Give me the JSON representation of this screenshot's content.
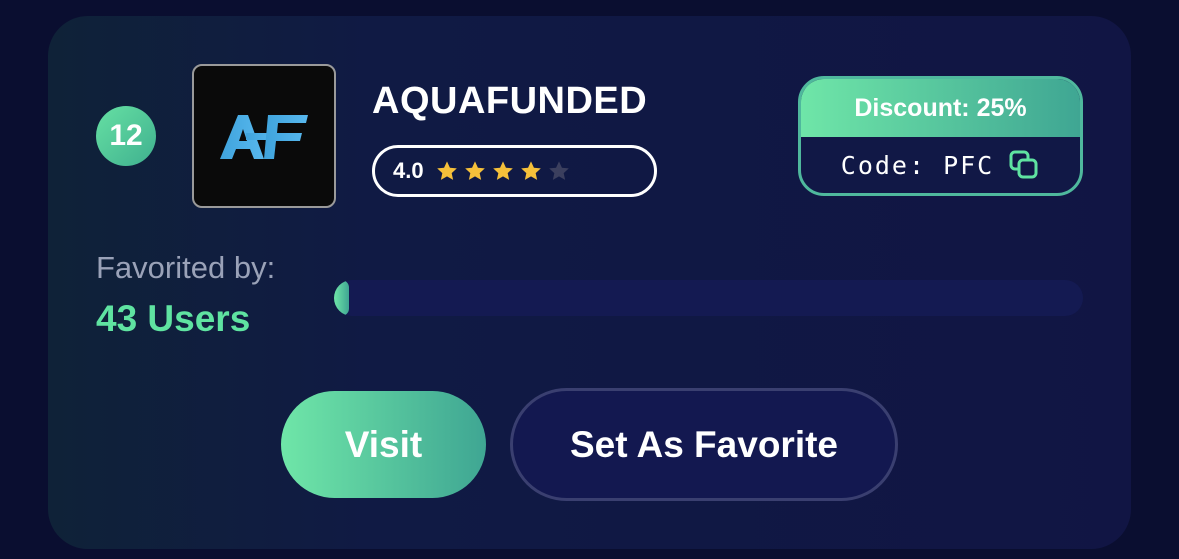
{
  "card": {
    "rank": "12",
    "logo_text": "AF",
    "name": "AQUAFUNDED",
    "rating": {
      "value": "4.0",
      "stars_filled": 4,
      "stars_total": 5,
      "star_color": "#f5c03a",
      "star_empty_color": "#3b3f5e"
    },
    "discount": {
      "label": "Discount: 25%",
      "code": "Code: PFC",
      "copy_icon": "copy-icon"
    },
    "favorites": {
      "label": "Favorited by:",
      "count": "43 Users",
      "progress_fraction": 0.02
    },
    "buttons": {
      "visit": "Visit",
      "favorite": "Set As Favorite"
    },
    "colors": {
      "accent": "#5fe3a1",
      "accent_dark": "#3fa693",
      "background": "#0a0e30"
    }
  }
}
